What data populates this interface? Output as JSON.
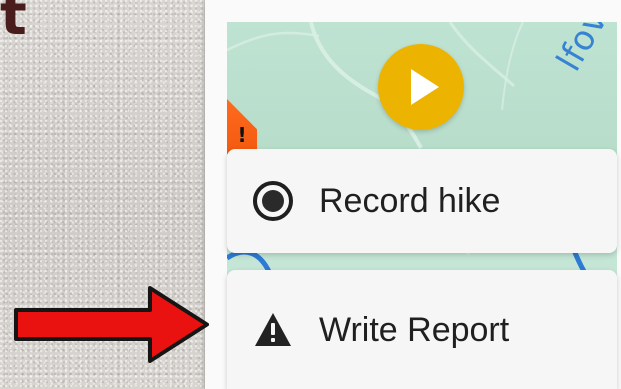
{
  "background": {
    "corner_text": "t"
  },
  "map": {
    "label_text": "lfov N",
    "play_button_icon": "play-icon",
    "orange_marker_icon": "warning-marker-icon",
    "colors": {
      "map_green": "#bfe3d2",
      "route_blue": "#2c7bd4",
      "play_yellow": "#ecb400",
      "orange_marker": "#f25a10"
    }
  },
  "menu": {
    "items": [
      {
        "label": "Record hike",
        "icon": "record-icon"
      },
      {
        "label": "Write Report",
        "icon": "warning-triangle-icon"
      }
    ]
  },
  "annotation": {
    "arrow_icon": "red-arrow-icon",
    "arrow_color": "#ea1111"
  }
}
